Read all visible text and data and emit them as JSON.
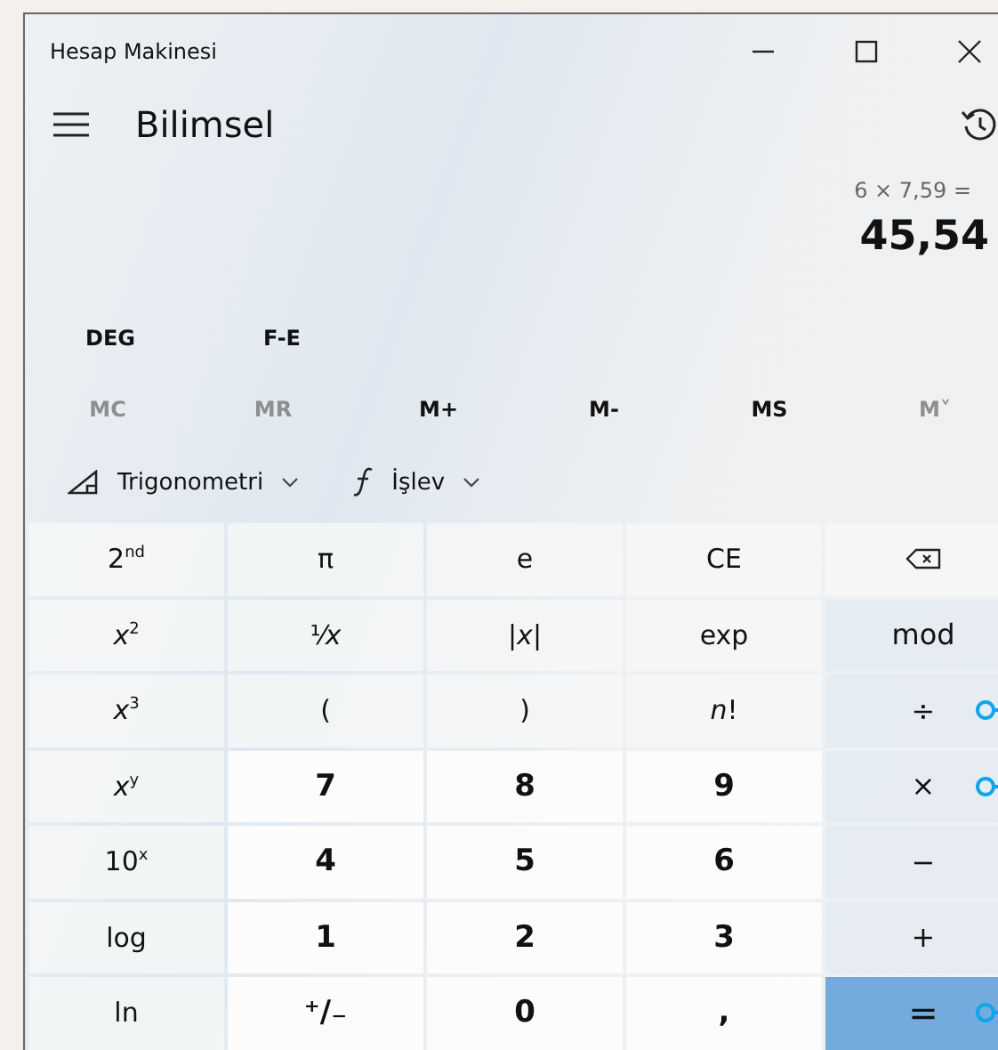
{
  "window": {
    "title": "Hesap Makinesi"
  },
  "header": {
    "mode": "Bilimsel"
  },
  "display": {
    "expression": "6 × 7,59 =",
    "result": "45,54"
  },
  "mode_toggles": [
    "DEG",
    "F-E"
  ],
  "memory": [
    {
      "label": "MC",
      "disabled": true
    },
    {
      "label": "MR",
      "disabled": true
    },
    {
      "label": "M+",
      "disabled": false
    },
    {
      "label": "M-",
      "disabled": false
    },
    {
      "label": "MS",
      "disabled": false
    },
    {
      "label": "M˅",
      "disabled": true
    }
  ],
  "menus": [
    {
      "kind": "trig",
      "label": "Trigonometri"
    },
    {
      "kind": "function",
      "label": "İşlev"
    }
  ],
  "keys": [
    {
      "kind": "function",
      "label": "2$^{nd}$"
    },
    {
      "kind": "function",
      "label": "π"
    },
    {
      "kind": "function",
      "label": "e"
    },
    {
      "kind": "function",
      "label": "CE"
    },
    {
      "kind": "backspace"
    },
    {
      "kind": "function",
      "label": "*x*$^{2}$"
    },
    {
      "kind": "function",
      "label": "¹⁄*x*"
    },
    {
      "kind": "function",
      "label": "|*x*|"
    },
    {
      "kind": "function",
      "label": "exp"
    },
    {
      "kind": "operator",
      "label": "mod"
    },
    {
      "kind": "function",
      "label": "*x*$^{3}$"
    },
    {
      "kind": "function",
      "label": "("
    },
    {
      "kind": "function",
      "label": ")"
    },
    {
      "kind": "function",
      "label": "*n*!"
    },
    {
      "kind": "operator",
      "label": "÷",
      "marker": true
    },
    {
      "kind": "function",
      "label": "*x*$^{y}$"
    },
    {
      "kind": "digit",
      "label": "7"
    },
    {
      "kind": "digit",
      "label": "8"
    },
    {
      "kind": "digit",
      "label": "9"
    },
    {
      "kind": "operator",
      "label": "×",
      "marker": true
    },
    {
      "kind": "function",
      "label": "10$^{x}$"
    },
    {
      "kind": "digit",
      "label": "4"
    },
    {
      "kind": "digit",
      "label": "5"
    },
    {
      "kind": "digit",
      "label": "6"
    },
    {
      "kind": "operator",
      "label": "−"
    },
    {
      "kind": "function",
      "label": "log"
    },
    {
      "kind": "digit",
      "label": "1"
    },
    {
      "kind": "digit",
      "label": "2"
    },
    {
      "kind": "digit",
      "label": "3"
    },
    {
      "kind": "operator",
      "label": "+"
    },
    {
      "kind": "function",
      "label": "ln"
    },
    {
      "kind": "digit",
      "label": "⁺∕₋"
    },
    {
      "kind": "digit",
      "label": "0"
    },
    {
      "kind": "digit",
      "label": ","
    },
    {
      "kind": "equals",
      "label": "=",
      "marker": true
    }
  ]
}
